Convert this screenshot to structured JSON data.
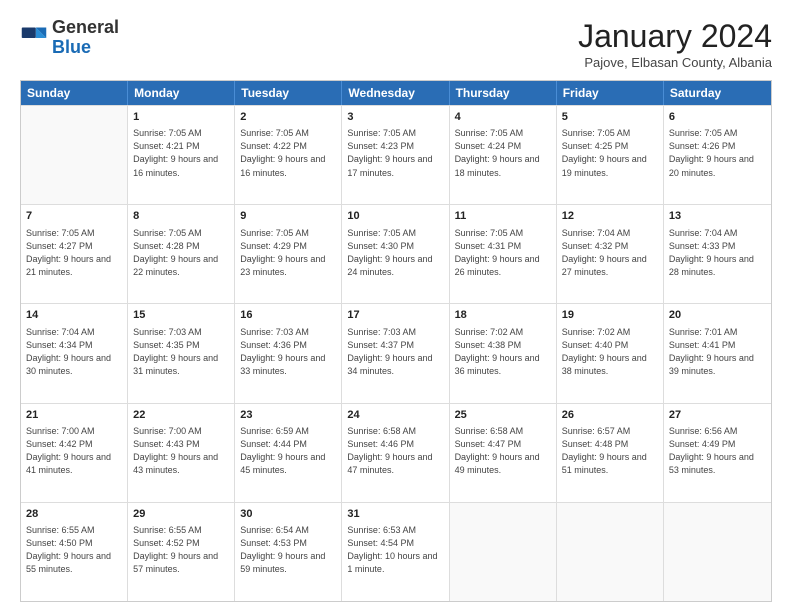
{
  "header": {
    "logo_general": "General",
    "logo_blue": "Blue",
    "month_title": "January 2024",
    "subtitle": "Pajove, Elbasan County, Albania"
  },
  "weekdays": [
    "Sunday",
    "Monday",
    "Tuesday",
    "Wednesday",
    "Thursday",
    "Friday",
    "Saturday"
  ],
  "weeks": [
    [
      {
        "date": "",
        "sunrise": "",
        "sunset": "",
        "daylight": ""
      },
      {
        "date": "1",
        "sunrise": "Sunrise: 7:05 AM",
        "sunset": "Sunset: 4:21 PM",
        "daylight": "Daylight: 9 hours and 16 minutes."
      },
      {
        "date": "2",
        "sunrise": "Sunrise: 7:05 AM",
        "sunset": "Sunset: 4:22 PM",
        "daylight": "Daylight: 9 hours and 16 minutes."
      },
      {
        "date": "3",
        "sunrise": "Sunrise: 7:05 AM",
        "sunset": "Sunset: 4:23 PM",
        "daylight": "Daylight: 9 hours and 17 minutes."
      },
      {
        "date": "4",
        "sunrise": "Sunrise: 7:05 AM",
        "sunset": "Sunset: 4:24 PM",
        "daylight": "Daylight: 9 hours and 18 minutes."
      },
      {
        "date": "5",
        "sunrise": "Sunrise: 7:05 AM",
        "sunset": "Sunset: 4:25 PM",
        "daylight": "Daylight: 9 hours and 19 minutes."
      },
      {
        "date": "6",
        "sunrise": "Sunrise: 7:05 AM",
        "sunset": "Sunset: 4:26 PM",
        "daylight": "Daylight: 9 hours and 20 minutes."
      }
    ],
    [
      {
        "date": "7",
        "sunrise": "Sunrise: 7:05 AM",
        "sunset": "Sunset: 4:27 PM",
        "daylight": "Daylight: 9 hours and 21 minutes."
      },
      {
        "date": "8",
        "sunrise": "Sunrise: 7:05 AM",
        "sunset": "Sunset: 4:28 PM",
        "daylight": "Daylight: 9 hours and 22 minutes."
      },
      {
        "date": "9",
        "sunrise": "Sunrise: 7:05 AM",
        "sunset": "Sunset: 4:29 PM",
        "daylight": "Daylight: 9 hours and 23 minutes."
      },
      {
        "date": "10",
        "sunrise": "Sunrise: 7:05 AM",
        "sunset": "Sunset: 4:30 PM",
        "daylight": "Daylight: 9 hours and 24 minutes."
      },
      {
        "date": "11",
        "sunrise": "Sunrise: 7:05 AM",
        "sunset": "Sunset: 4:31 PM",
        "daylight": "Daylight: 9 hours and 26 minutes."
      },
      {
        "date": "12",
        "sunrise": "Sunrise: 7:04 AM",
        "sunset": "Sunset: 4:32 PM",
        "daylight": "Daylight: 9 hours and 27 minutes."
      },
      {
        "date": "13",
        "sunrise": "Sunrise: 7:04 AM",
        "sunset": "Sunset: 4:33 PM",
        "daylight": "Daylight: 9 hours and 28 minutes."
      }
    ],
    [
      {
        "date": "14",
        "sunrise": "Sunrise: 7:04 AM",
        "sunset": "Sunset: 4:34 PM",
        "daylight": "Daylight: 9 hours and 30 minutes."
      },
      {
        "date": "15",
        "sunrise": "Sunrise: 7:03 AM",
        "sunset": "Sunset: 4:35 PM",
        "daylight": "Daylight: 9 hours and 31 minutes."
      },
      {
        "date": "16",
        "sunrise": "Sunrise: 7:03 AM",
        "sunset": "Sunset: 4:36 PM",
        "daylight": "Daylight: 9 hours and 33 minutes."
      },
      {
        "date": "17",
        "sunrise": "Sunrise: 7:03 AM",
        "sunset": "Sunset: 4:37 PM",
        "daylight": "Daylight: 9 hours and 34 minutes."
      },
      {
        "date": "18",
        "sunrise": "Sunrise: 7:02 AM",
        "sunset": "Sunset: 4:38 PM",
        "daylight": "Daylight: 9 hours and 36 minutes."
      },
      {
        "date": "19",
        "sunrise": "Sunrise: 7:02 AM",
        "sunset": "Sunset: 4:40 PM",
        "daylight": "Daylight: 9 hours and 38 minutes."
      },
      {
        "date": "20",
        "sunrise": "Sunrise: 7:01 AM",
        "sunset": "Sunset: 4:41 PM",
        "daylight": "Daylight: 9 hours and 39 minutes."
      }
    ],
    [
      {
        "date": "21",
        "sunrise": "Sunrise: 7:00 AM",
        "sunset": "Sunset: 4:42 PM",
        "daylight": "Daylight: 9 hours and 41 minutes."
      },
      {
        "date": "22",
        "sunrise": "Sunrise: 7:00 AM",
        "sunset": "Sunset: 4:43 PM",
        "daylight": "Daylight: 9 hours and 43 minutes."
      },
      {
        "date": "23",
        "sunrise": "Sunrise: 6:59 AM",
        "sunset": "Sunset: 4:44 PM",
        "daylight": "Daylight: 9 hours and 45 minutes."
      },
      {
        "date": "24",
        "sunrise": "Sunrise: 6:58 AM",
        "sunset": "Sunset: 4:46 PM",
        "daylight": "Daylight: 9 hours and 47 minutes."
      },
      {
        "date": "25",
        "sunrise": "Sunrise: 6:58 AM",
        "sunset": "Sunset: 4:47 PM",
        "daylight": "Daylight: 9 hours and 49 minutes."
      },
      {
        "date": "26",
        "sunrise": "Sunrise: 6:57 AM",
        "sunset": "Sunset: 4:48 PM",
        "daylight": "Daylight: 9 hours and 51 minutes."
      },
      {
        "date": "27",
        "sunrise": "Sunrise: 6:56 AM",
        "sunset": "Sunset: 4:49 PM",
        "daylight": "Daylight: 9 hours and 53 minutes."
      }
    ],
    [
      {
        "date": "28",
        "sunrise": "Sunrise: 6:55 AM",
        "sunset": "Sunset: 4:50 PM",
        "daylight": "Daylight: 9 hours and 55 minutes."
      },
      {
        "date": "29",
        "sunrise": "Sunrise: 6:55 AM",
        "sunset": "Sunset: 4:52 PM",
        "daylight": "Daylight: 9 hours and 57 minutes."
      },
      {
        "date": "30",
        "sunrise": "Sunrise: 6:54 AM",
        "sunset": "Sunset: 4:53 PM",
        "daylight": "Daylight: 9 hours and 59 minutes."
      },
      {
        "date": "31",
        "sunrise": "Sunrise: 6:53 AM",
        "sunset": "Sunset: 4:54 PM",
        "daylight": "Daylight: 10 hours and 1 minute."
      },
      {
        "date": "",
        "sunrise": "",
        "sunset": "",
        "daylight": ""
      },
      {
        "date": "",
        "sunrise": "",
        "sunset": "",
        "daylight": ""
      },
      {
        "date": "",
        "sunrise": "",
        "sunset": "",
        "daylight": ""
      }
    ]
  ]
}
